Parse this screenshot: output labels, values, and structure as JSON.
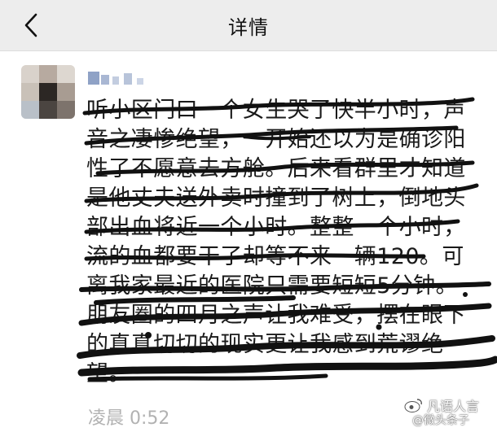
{
  "nav": {
    "title": "详情"
  },
  "post": {
    "lines": [
      "听小区门口一个女生哭了快半小时，声",
      "音之凄惨绝望，一开始还以为是确诊阳",
      "性了不愿意去方舱。后来看群里才知道",
      "是他丈夫送外卖时撞到了树上，倒地头",
      "部出血将近一个小时。整整一个小时，",
      "流的血都要干了却等不来一辆120。可",
      "离我家最近的医院只需要短短5分钟。",
      "朋友圈的四月之声让我难受，摆在眼下",
      "的真真切切的现实更让我感到荒谬绝",
      "望。"
    ],
    "timestamp": "凌晨 0:52"
  },
  "watermark": {
    "title": "凡语人言",
    "subtitle": "@微头条子"
  },
  "colors": {
    "nav_background": "#ededed",
    "scribble": "#111111",
    "timestamp": "#b2b2b2",
    "nickname_blur": "#8fa2c6"
  },
  "icons": {
    "back": "chevron-left-icon",
    "watermark": "weibo-logo-icon"
  }
}
